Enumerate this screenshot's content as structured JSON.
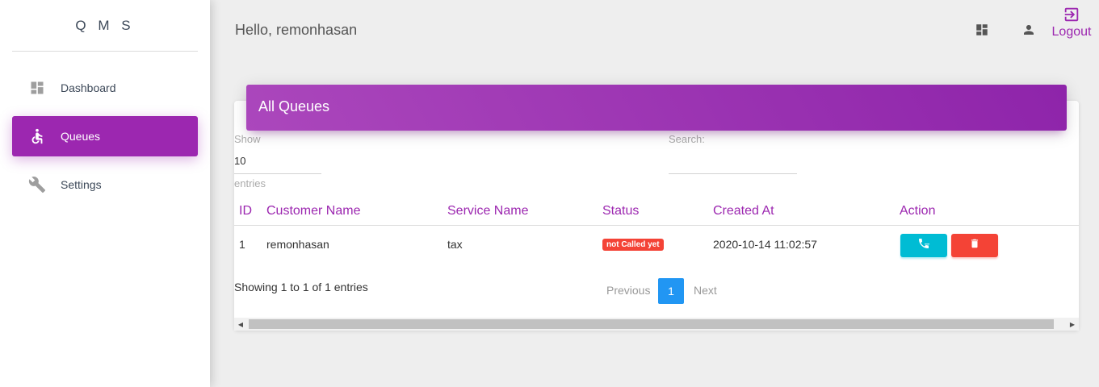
{
  "brand": "Q M S",
  "sidebar": {
    "items": [
      {
        "label": "Dashboard",
        "icon": "dashboard-icon"
      },
      {
        "label": "Queues",
        "icon": "accessible-icon"
      },
      {
        "label": "Settings",
        "icon": "wrench-icon"
      }
    ]
  },
  "header": {
    "greeting": "Hello, remonhasan",
    "logout_label": "Logout"
  },
  "card": {
    "title": "All Queues",
    "show_label": "Show",
    "length_value": "10",
    "entries_label": "entries",
    "search_label": "Search:",
    "columns": [
      "ID",
      "Customer Name",
      "Service Name",
      "Status",
      "Created At",
      "Action"
    ],
    "rows": [
      {
        "id": "1",
        "customer_name": "remonhasan",
        "service_name": "tax",
        "status": "not Called yet",
        "created_at": "2020-10-14 11:02:57"
      }
    ],
    "info": "Showing 1 to 1 of 1 entries",
    "pagination": {
      "previous": "Previous",
      "current": "1",
      "next": "Next"
    }
  },
  "colors": {
    "accent": "#9c27b0",
    "call_button": "#00bcd4",
    "delete_button": "#f44336",
    "page_active": "#2196f3"
  }
}
